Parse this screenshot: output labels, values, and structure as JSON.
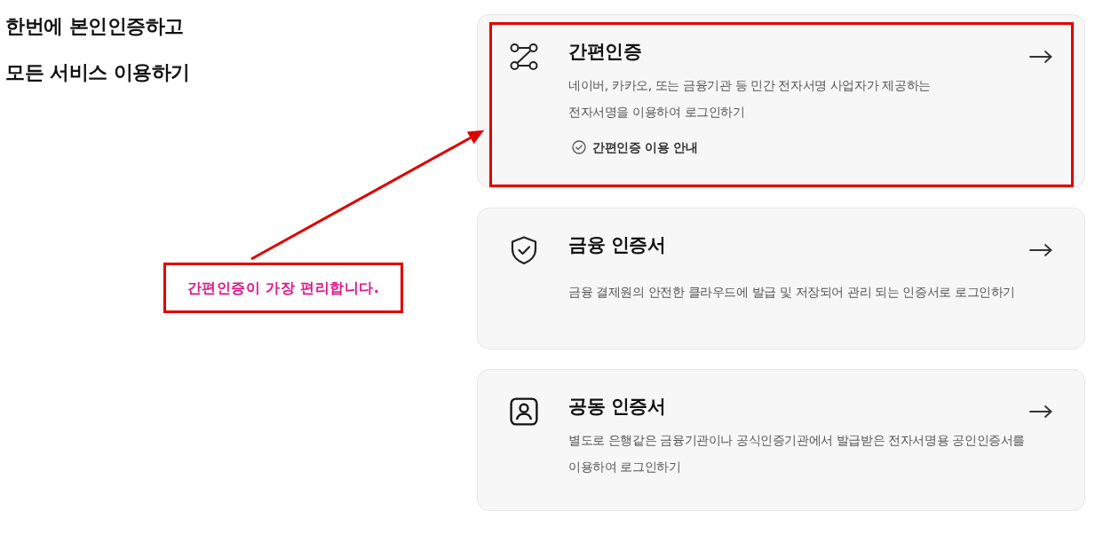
{
  "headline": [
    "한번에 본인인증하고",
    "모든 서비스 이용하기"
  ],
  "cards": [
    {
      "title": "간편인증",
      "description_lines": [
        "네이버, 카카오, 또는 금융기관 등 민간 전자서명 사업자가 제공하는",
        "전자서명을 이용하여 로그인하기"
      ],
      "guide": {
        "label": "간편인증 이용 안내"
      },
      "highlighted": true
    },
    {
      "title": "금융 인증서",
      "description_lines": [
        "금융 결제원의 안전한 클라우드에 발급 및 저장되어 관리 되는 인증서로 로그인하기"
      ],
      "highlighted": false
    },
    {
      "title": "공동 인증서",
      "description_lines": [
        "별도로 은행같은 금융기관이나 공식인증기관에서 발급받은 전자서명용 공인인증서를",
        "이용하여 로그인하기"
      ],
      "highlighted": false
    }
  ],
  "annotation": {
    "text": "간편인증이 가장 편리합니다."
  }
}
